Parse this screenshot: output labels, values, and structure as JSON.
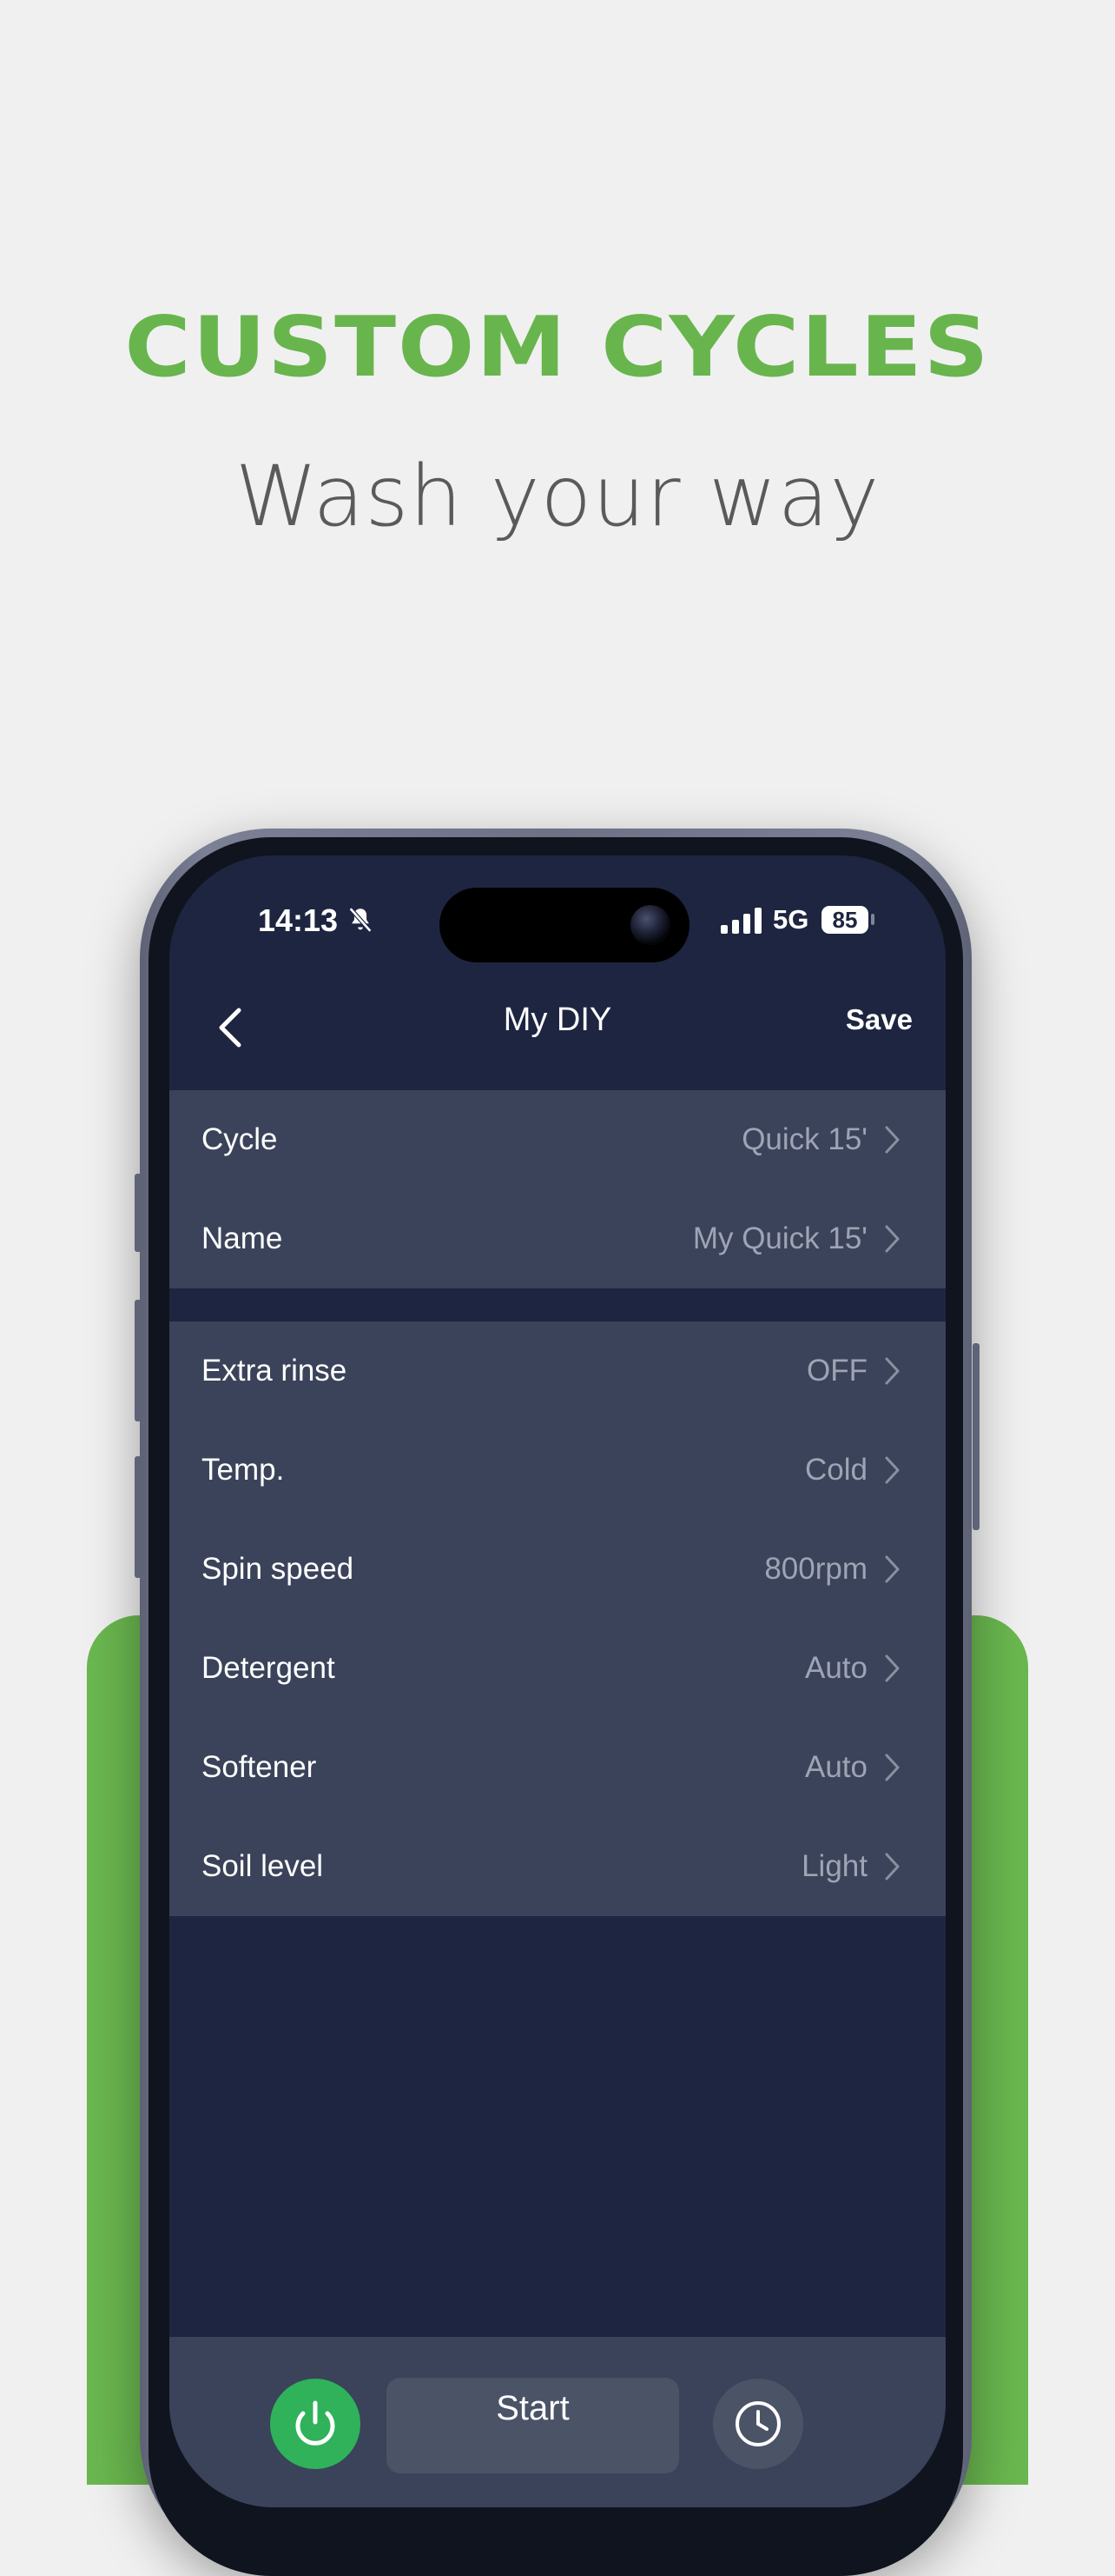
{
  "promo": {
    "headline": "CUSTOM CYCLES",
    "subheadline": "Wash your way"
  },
  "status_bar": {
    "time": "14:13",
    "network": "5G",
    "battery": "85"
  },
  "nav": {
    "title": "My DIY",
    "save_label": "Save"
  },
  "groups": [
    {
      "rows": [
        {
          "label": "Cycle",
          "value": "Quick 15'"
        },
        {
          "label": "Name",
          "value": "My Quick 15'"
        }
      ]
    },
    {
      "rows": [
        {
          "label": "Extra rinse",
          "value": "OFF"
        },
        {
          "label": "Temp.",
          "value": "Cold"
        },
        {
          "label": "Spin speed",
          "value": "800rpm"
        },
        {
          "label": "Detergent",
          "value": "Auto"
        },
        {
          "label": "Softener",
          "value": "Auto"
        },
        {
          "label": "Soil level",
          "value": "Light"
        }
      ]
    }
  ],
  "bottom_bar": {
    "start_label": "Start"
  },
  "colors": {
    "brand_green": "#68b54e",
    "screen_bg": "#1e2540",
    "row_bg": "#3a4359",
    "power_green": "#2fb25a"
  },
  "icons": [
    "bell-slash-icon",
    "signal-icon",
    "battery-icon",
    "back-chevron-icon",
    "chevron-right-icon",
    "power-icon",
    "timer-icon"
  ]
}
